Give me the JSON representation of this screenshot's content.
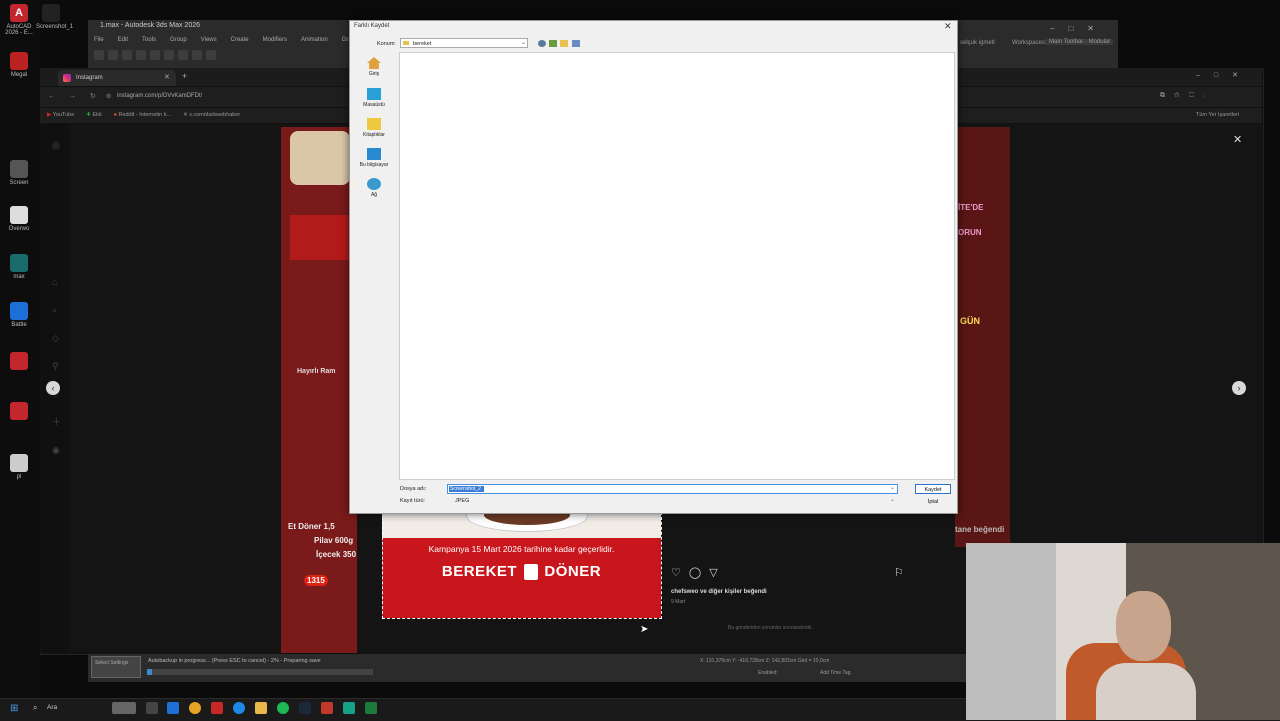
{
  "desktop": {
    "icons": [
      {
        "label": "AutoCAD 2026 - E..."
      },
      {
        "label": "Screenshot_1"
      },
      {
        "label": "Megal"
      },
      {
        "label": "Screen"
      },
      {
        "label": "Overwo"
      },
      {
        "label": "max"
      },
      {
        "label": "Battle"
      },
      {
        "label": "pl"
      }
    ]
  },
  "max": {
    "title": "1.max - Autodesk 3ds Max 2026",
    "menu": [
      "File",
      "Edit",
      "Tools",
      "Group",
      "Views",
      "Create",
      "Modifiers",
      "Animation",
      "Graph"
    ],
    "right_label_1": "selçuk igmetl",
    "right_label_2": "Workspaces:",
    "right_label_3": "Main Toolbar - Modular",
    "status_text": "Autobackup in progress... (Press ESC to cancel) - 2% - Preparing save",
    "status_progress": 0.02,
    "status_coords": "X: 131,376cm  Y: -416,728cm  Z: 142,803cm  Grid = 10,0cm",
    "status_enabled": "Enabled:",
    "status_add_tag": "Add Time Tag",
    "left_box_label": "Select Settings"
  },
  "browser": {
    "tab_title": "Instagram",
    "url": "instagram.com/p/DVvKamDFDt/",
    "bookmarks": [
      "YouTube",
      "Ekti",
      "Reddit - Internetin k...",
      "x.com/darkwebhaber"
    ],
    "bookmarks_right": "Tüm Yer İşaretleri"
  },
  "post": {
    "campaign_text": "Kampanya 15 Mart 2026 tarihine kadar geçerlidir.",
    "brand_left": "BEREKET",
    "brand_right": "DÖNER",
    "likes": "chefsweo ve diğer kişiler beğendi",
    "date": "9 Mart",
    "comments_empty": "Bu gönderiden yorumlar sınırlandırıldı."
  },
  "background_post": {
    "label_1": "Hayırlı Ram",
    "label_2": "Et Döner 1,5",
    "label_3": "Pilav 600g",
    "label_4": "İçecek 350",
    "price": "1315",
    "right_1": "İTE'DE",
    "right_2": "ORUN",
    "right_3": "GÜN",
    "right_4": "tane beğendi"
  },
  "dialog": {
    "title": "Farklı Kaydet",
    "konum_label": "Konum:",
    "konum_value": "bereket",
    "nav_items": [
      {
        "label": "Giriş"
      },
      {
        "label": "Masaüstü"
      },
      {
        "label": "Kitaplıklar"
      },
      {
        "label": "Bu bilgisayar"
      },
      {
        "label": "Ağ"
      }
    ],
    "filename_label": "Dosya adı:",
    "filename_value": "Screenshot_2",
    "filetype_label": "Kayıt türü:",
    "filetype_value": "JPEG",
    "save_label": "Kaydet",
    "cancel_label": "İptal"
  },
  "taskbar": {
    "search_placeholder": "Ara"
  },
  "colors": {
    "brand_red": "#c8161c",
    "selection_blue": "#3a7bd5"
  }
}
